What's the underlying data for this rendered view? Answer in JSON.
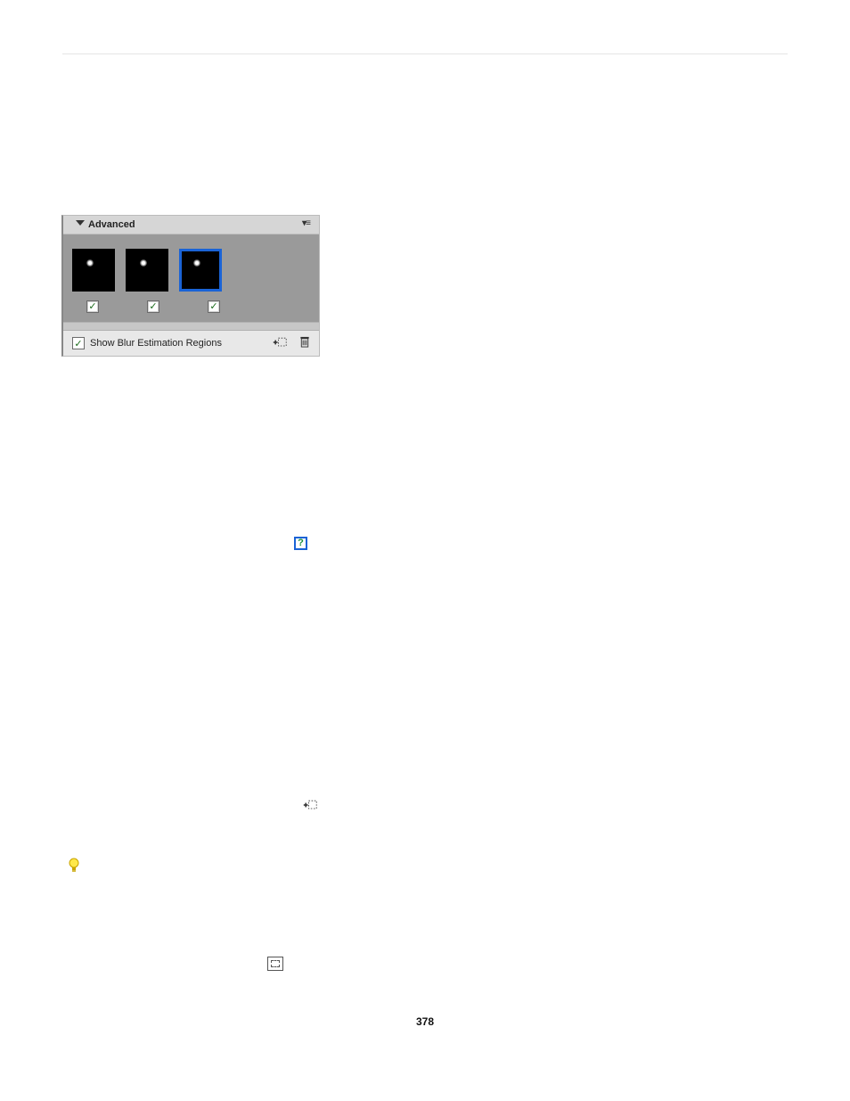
{
  "panel": {
    "title": "Advanced",
    "show_blur_label": "Show Blur Estimation Regions",
    "show_blur_checked": true,
    "thumb_checks": [
      true,
      true,
      true
    ]
  },
  "icons": {
    "help": "?",
    "check": "✓"
  },
  "page_number": "378"
}
